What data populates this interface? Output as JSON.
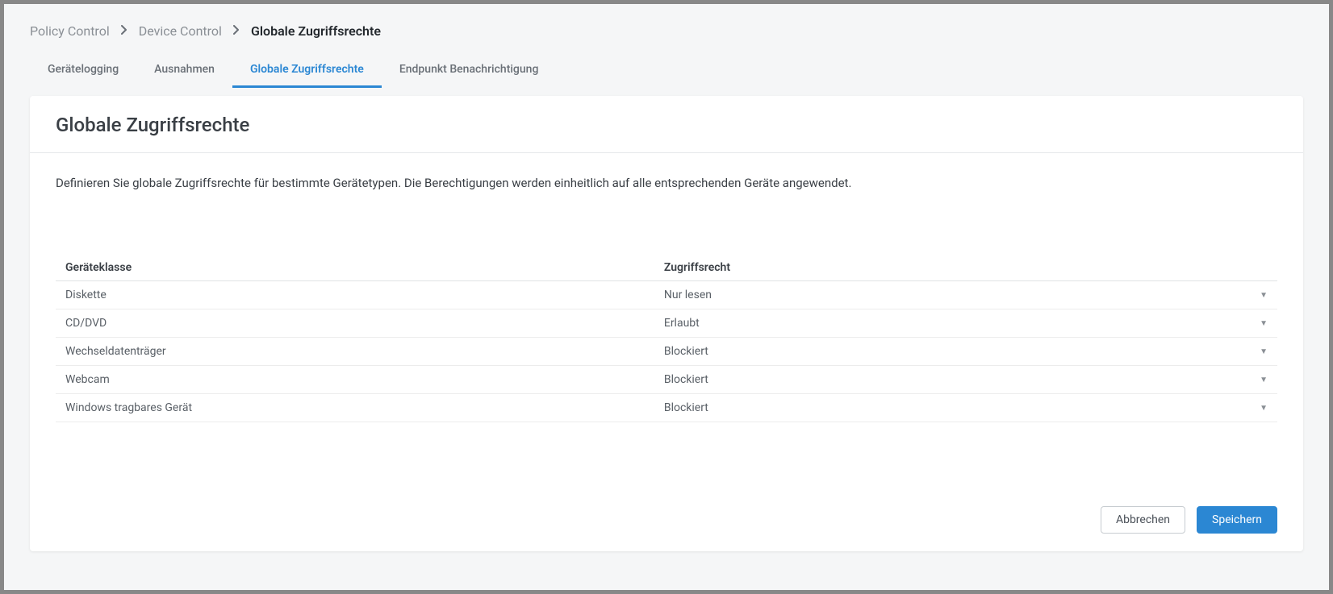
{
  "breadcrumb": {
    "items": [
      {
        "label": "Policy Control"
      },
      {
        "label": "Device Control"
      },
      {
        "label": "Globale Zugriffsrechte"
      }
    ]
  },
  "tabs": [
    {
      "label": "Gerätelogging",
      "active": false
    },
    {
      "label": "Ausnahmen",
      "active": false
    },
    {
      "label": "Globale Zugriffsrechte",
      "active": true
    },
    {
      "label": "Endpunkt Benachrichtigung",
      "active": false
    }
  ],
  "page": {
    "title": "Globale Zugriffsrechte",
    "description": "Definieren Sie globale Zugriffsrechte für bestimmte Gerätetypen. Die Berechtigungen werden einheitlich auf alle entsprechenden Geräte angewendet."
  },
  "table": {
    "headers": {
      "device_class": "Geräteklasse",
      "permission": "Zugriffsrecht"
    },
    "rows": [
      {
        "device_class": "Diskette",
        "permission": "Nur lesen"
      },
      {
        "device_class": "CD/DVD",
        "permission": "Erlaubt"
      },
      {
        "device_class": "Wechseldatenträger",
        "permission": "Blockiert"
      },
      {
        "device_class": "Webcam",
        "permission": "Blockiert"
      },
      {
        "device_class": "Windows tragbares Gerät",
        "permission": "Blockiert"
      }
    ]
  },
  "footer": {
    "cancel": "Abbrechen",
    "save": "Speichern"
  }
}
